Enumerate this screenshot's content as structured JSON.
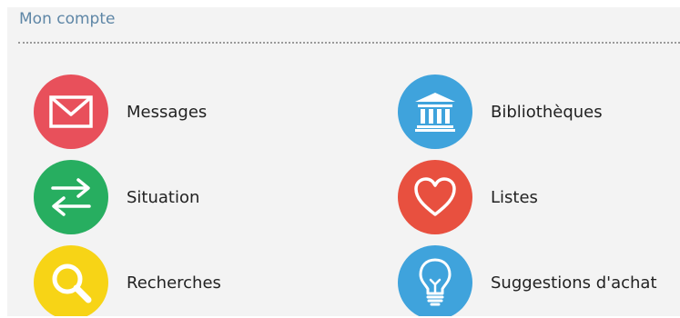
{
  "section": {
    "title": "Mon compte"
  },
  "tiles": [
    {
      "id": "messages",
      "label": "Messages",
      "icon": "envelope-icon",
      "color": "#e8505b"
    },
    {
      "id": "situation",
      "label": "Situation",
      "icon": "exchange-arrows-icon",
      "color": "#27ae60"
    },
    {
      "id": "recherches",
      "label": "Recherches",
      "icon": "search-icon",
      "color": "#f7d416"
    },
    {
      "id": "bibliotheques",
      "label": "Bibliothèques",
      "icon": "library-building-icon",
      "color": "#3fa3dc"
    },
    {
      "id": "listes",
      "label": "Listes",
      "icon": "heart-icon",
      "color": "#e8503f"
    },
    {
      "id": "suggestions",
      "label": "Suggestions d'achat",
      "icon": "lightbulb-icon",
      "color": "#3fa3dc"
    }
  ]
}
